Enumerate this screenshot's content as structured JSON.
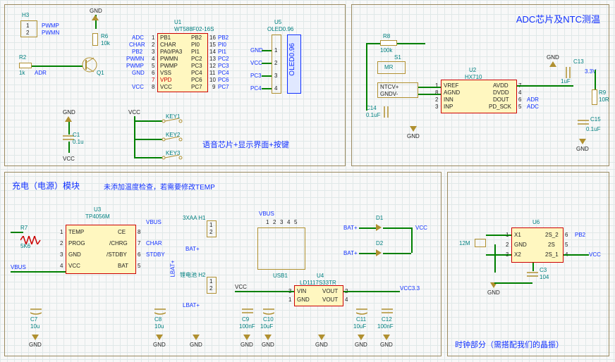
{
  "blocks": {
    "top_left": {
      "caption": "语音芯片+显示界面+按键",
      "H3": {
        "ref": "H3",
        "pins": [
          "1",
          "2"
        ],
        "nets": [
          "PWMP",
          "PWMN"
        ]
      },
      "R2": {
        "ref": "R2",
        "val": "1k",
        "net": "ADR"
      },
      "R6": {
        "ref": "R6",
        "val": "10k"
      },
      "Q1": {
        "ref": "Q1"
      },
      "U1": {
        "ref": "U1",
        "part": "WT588F02-16S",
        "left_pins": [
          "PB1",
          "CHAR",
          "PA0/PA3",
          "PWMN",
          "PWMP",
          "VSS",
          "VPD",
          "VCC"
        ],
        "left_nums": [
          "1",
          "2",
          "3",
          "4",
          "5",
          "6",
          "7",
          "8"
        ],
        "left_nets": [
          "ADC",
          "CHAR",
          "PB2",
          "PWMN",
          "PWMP",
          "GND",
          "",
          "VCC"
        ],
        "right_pins": [
          "PB2",
          "PI0",
          "PI1",
          "PC2",
          "PC3",
          "PC4",
          "PC6",
          "PC7"
        ],
        "right_nums": [
          "16",
          "15",
          "14",
          "13",
          "12",
          "11",
          "10",
          "9"
        ],
        "right_nets": [
          "PB2",
          "PI0",
          "PI1",
          "PC2",
          "PC3",
          "PC4",
          "PC6",
          "PC7"
        ]
      },
      "U5": {
        "ref": "U5",
        "part": "OLED0.96",
        "text": "OLED0.96",
        "pins": [
          "GND",
          "VCC",
          "PC3",
          "PC4"
        ],
        "nums": [
          "1",
          "2",
          "3",
          "4"
        ]
      },
      "GND_top": "GND",
      "VCC_left": "VCC",
      "VCC_key": "VCC",
      "GND_bot": "GND",
      "C1": {
        "ref": "C1",
        "val": "0.1u"
      },
      "keys": [
        "KEY1",
        "KEY2",
        "KEY3"
      ]
    },
    "top_right": {
      "title": "ADC芯片及NTC测温",
      "R8": {
        "ref": "R8",
        "val": "100k"
      },
      "S1": {
        "ref": "S1",
        "part": "MR"
      },
      "NTC": {
        "p": "NTCV+",
        "n": "GNDV-"
      },
      "C14": {
        "ref": "C14",
        "val": "0.1uF"
      },
      "C13": {
        "ref": "C13",
        "val": "1uF"
      },
      "C15": {
        "ref": "C15",
        "val": "0.1uF"
      },
      "R9": {
        "ref": "R9",
        "val": "10R"
      },
      "V33": "3.3V",
      "GND": "GND",
      "U2": {
        "ref": "U2",
        "part": "HX710",
        "left": [
          "VREF",
          "INN",
          "INP"
        ],
        "left_mid": "AGND",
        "left_nums": [
          "1",
          "8",
          "2",
          "3"
        ],
        "right": [
          "AVDD",
          "DVDD",
          "DOUT",
          "PD_SCK"
        ],
        "right_nums": [
          "7",
          "4",
          "6",
          "5"
        ],
        "right_nets": [
          "",
          "",
          "ADR",
          "ADC"
        ]
      }
    },
    "charge": {
      "title": "充电（电源）模块",
      "note": "未添加温度检查，若需要修改TEMP",
      "R7": {
        "ref": "R7",
        "val": "5K6"
      },
      "VBUS": "VBUS",
      "U3": {
        "ref": "U3",
        "part": "TP4056M",
        "left": [
          "TEMP",
          "PROG",
          "GND",
          "VCC"
        ],
        "right": [
          "CE",
          "/CHRG",
          "/STDBY",
          "BAT"
        ],
        "right_nets": [
          "",
          "CHAR",
          "STDBY",
          "LBAT+"
        ],
        "left_nums": [
          "1",
          "2",
          "3",
          "4"
        ],
        "right_nums": [
          "8",
          "7",
          "6",
          "5"
        ]
      },
      "H1": {
        "ref": "3XAA H1",
        "pins": [
          "1",
          "2"
        ],
        "net": "BAT+"
      },
      "H2": {
        "ref": "锂电池 H2",
        "pins": [
          "1",
          "2"
        ],
        "net": "LBAT+"
      },
      "USB": {
        "ref": "USB1",
        "net": "VBUS",
        "pins": [
          "1",
          "2",
          "3",
          "4",
          "5"
        ]
      },
      "D1": {
        "ref": "D1",
        "net_in": "BAT+",
        "net_out": "VCC"
      },
      "D2": {
        "ref": "D2",
        "net_in": "BAT+"
      },
      "U4": {
        "ref": "U4",
        "part": "LD1117S33TR",
        "left": [
          "VIN",
          "GND"
        ],
        "right": [
          "VOUT",
          "VOUT"
        ],
        "left_nums": [
          "3",
          "1"
        ],
        "right_nums": [
          "2",
          "4"
        ],
        "out_net": "VCC3.3"
      },
      "C7": {
        "ref": "C7",
        "val": "10u"
      },
      "C8": {
        "ref": "C8",
        "val": "10u"
      },
      "C9": {
        "ref": "C9",
        "val": "100nF"
      },
      "C10": {
        "ref": "C10",
        "val": "10uF"
      },
      "C11": {
        "ref": "C11",
        "val": "10uF"
      },
      "C12": {
        "ref": "C12",
        "val": "100nF"
      },
      "VCC": "VCC",
      "GND": "GND"
    },
    "clock": {
      "caption": "时钟部分（需搭配我们的晶振）",
      "U6": {
        "ref": "U6",
        "left": [
          "X1",
          "GND",
          "X2"
        ],
        "right": [
          "2S_2",
          "2S",
          "2S_1"
        ],
        "left_nums": [
          "1",
          "2",
          "3"
        ],
        "right_nums": [
          "6",
          "5",
          "4"
        ],
        "nets": {
          "pb2": "PB2",
          "vcc": "VCC"
        }
      },
      "XTAL": "12M",
      "C3": {
        "ref": "C3",
        "val": "104"
      },
      "GND": "GND"
    }
  }
}
